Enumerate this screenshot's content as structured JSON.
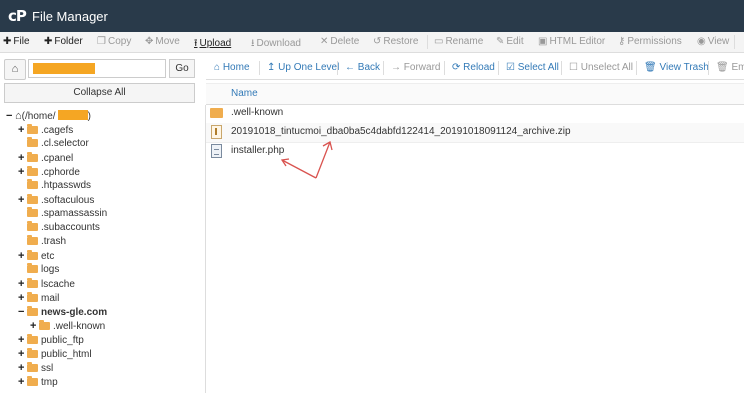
{
  "header": {
    "logo": "cP",
    "title": "File Manager"
  },
  "toolbar": {
    "file": "File",
    "folder": "Folder",
    "copy": "Copy",
    "move": "Move",
    "upload": "Upload",
    "download": "Download",
    "delete": "Delete",
    "restore": "Restore",
    "rename": "Rename",
    "edit": "Edit",
    "html_editor": "HTML Editor",
    "permissions": "Permissions",
    "view": "View"
  },
  "left": {
    "go": "Go",
    "collapse_all": "Collapse All"
  },
  "tree": {
    "root_prefix": "(/home/",
    "root_suffix": ")",
    "items": [
      ".cagefs",
      ".cl.selector",
      ".cpanel",
      ".cphorde",
      ".htpasswds",
      ".softaculous",
      ".spamassassin",
      ".subaccounts",
      ".trash",
      "etc",
      "logs",
      "lscache",
      "mail",
      "news-gle.com",
      ".well-known",
      "public_ftp",
      "public_html",
      "ssl",
      "tmp"
    ]
  },
  "right_toolbar": {
    "home": "Home",
    "up": "Up One Level",
    "back": "Back",
    "forward": "Forward",
    "reload": "Reload",
    "select_all": "Select All",
    "unselect_all": "Unselect All",
    "view_trash": "View Trash",
    "empty": "Emp"
  },
  "files": {
    "header": "Name",
    "rows": [
      ".well-known",
      "20191018_tintucmoi_dba0ba5c4dabfd122414_20191018091124_archive.zip",
      "installer.php"
    ]
  },
  "colors": {
    "header_bg": "#293a4a",
    "link": "#337ab7",
    "folder": "#f0ad4e",
    "annotation": "#d9534f",
    "redaction": "#f5a623"
  }
}
